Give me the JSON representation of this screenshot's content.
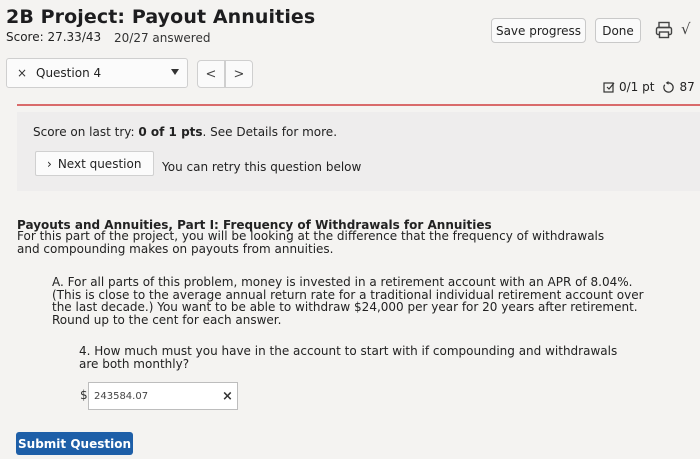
{
  "header": {
    "title": "2B Project: Payout Annuities",
    "score_text": "Score: 27.33/43",
    "answered_text": "20/27 answered",
    "save_label": "Save progress",
    "done_label": "Done",
    "sqrt_symbol": "√"
  },
  "question_nav": {
    "status_icon": "×",
    "question_label": "Question 4",
    "prev_symbol": "<",
    "next_symbol": ">"
  },
  "points": {
    "pts_text": "0/1 pt",
    "retry_count": "87"
  },
  "feedback": {
    "score_prefix": "Score on last try: ",
    "score_value": "0 of 1 pts",
    "score_suffix": ". See Details for more.",
    "next_question_label": "Next question",
    "retry_message": "You can retry this question below"
  },
  "question": {
    "section_title": "Payouts and Annuities, Part I: Frequency of Withdrawals for Annuities",
    "section_intro": "For this part of the project, you will be looking at the difference that the frequency of withdrawals and compounding makes on payouts from annuities.",
    "part_a": "A. For all parts of this problem, money is invested in a retirement account with an APR of 8.04%. (This is close to the average annual return rate for a traditional individual retirement account over the last decade.) You want to be able to withdraw $24,000 per year for 20 years after retirement. Round up to the cent for each answer.",
    "q4_text": "4. How much must you have in the account to start with if compounding and withdrawals are both monthly?",
    "currency_symbol": "$",
    "answer_value": "243584.07",
    "wrong_mark": "×"
  },
  "submit_label": "Submit Question",
  "colors": {
    "accent": "#1e5fa8",
    "divider": "#d96b6b",
    "background": "#f4f3f1"
  }
}
